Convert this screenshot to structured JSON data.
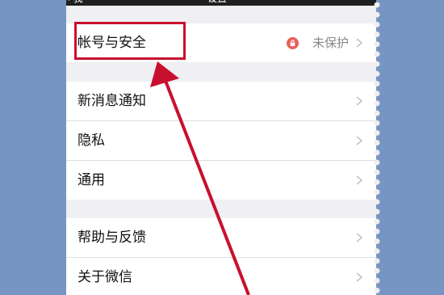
{
  "nav": {
    "back_label": "我",
    "title": "设置"
  },
  "sections": [
    {
      "items": [
        {
          "label": "帐号与安全",
          "status": "未保护"
        }
      ]
    },
    {
      "items": [
        {
          "label": "新消息通知"
        },
        {
          "label": "隐私"
        },
        {
          "label": "通用"
        }
      ]
    },
    {
      "items": [
        {
          "label": "帮助与反馈"
        },
        {
          "label": "关于微信"
        }
      ]
    }
  ],
  "icons": {
    "chevron": "chevron-right-icon",
    "lock": "lock-icon"
  },
  "colors": {
    "annotation": "#c8102e",
    "lock": "#e8605a",
    "background": "#7695c3"
  }
}
